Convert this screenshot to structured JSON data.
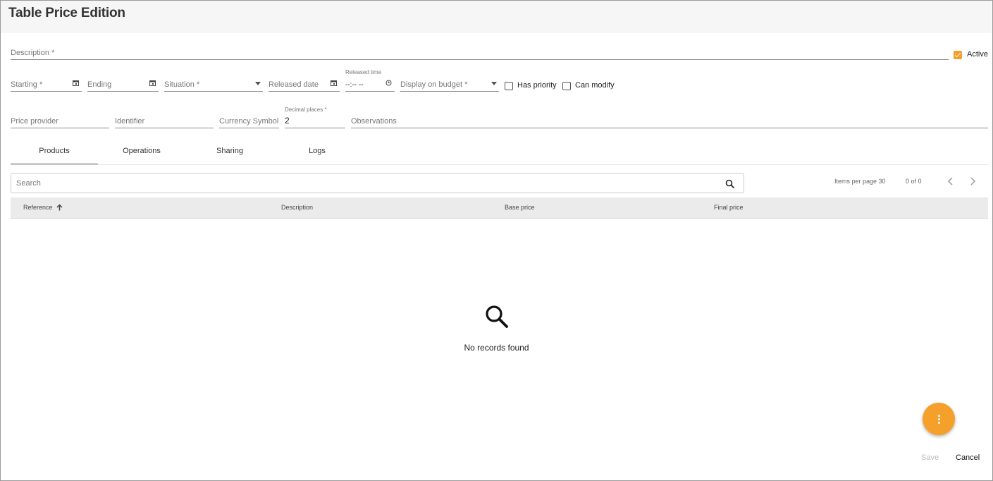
{
  "app": {
    "title": "Table Price Edition"
  },
  "form": {
    "description_placeholder": "Description *",
    "active_label": "Active",
    "active_checked": true,
    "starting_placeholder": "Starting *",
    "ending_placeholder": "Ending",
    "situation_placeholder": "Situation *",
    "released_date_placeholder": "Released date",
    "released_time_label": "Released time",
    "released_time_value": "--:-- --",
    "display_on_budget_placeholder": "Display on budget *",
    "has_priority_label": "Has priority",
    "has_priority_checked": false,
    "can_modify_label": "Can modify",
    "can_modify_checked": false,
    "price_provider_placeholder": "Price provider",
    "identifier_placeholder": "Identifier",
    "currency_symbol_placeholder": "Currency Symbol",
    "decimal_places_label": "Decimal places *",
    "decimal_places_value": "2",
    "observations_placeholder": "Observations"
  },
  "tabs": [
    {
      "label": "Products",
      "active": true
    },
    {
      "label": "Operations",
      "active": false
    },
    {
      "label": "Sharing",
      "active": false
    },
    {
      "label": "Logs",
      "active": false
    }
  ],
  "search": {
    "placeholder": "Search",
    "value": ""
  },
  "pager": {
    "items_per_page_label": "Items per page 30",
    "range_text": "0 of 0"
  },
  "table": {
    "columns": [
      {
        "label": "Reference",
        "sorted": "asc"
      },
      {
        "label": "Description"
      },
      {
        "label": "Base price"
      },
      {
        "label": "Final price"
      }
    ],
    "rows": []
  },
  "empty_state": {
    "text": "No records found",
    "icon": "search-icon"
  },
  "actions": {
    "save_label": "Save",
    "cancel_label": "Cancel",
    "fab_icon": "more-vert-icon"
  },
  "colors": {
    "accent": "#f5a02a",
    "header_bg": "#f6f6f6",
    "table_head_bg": "#ebebeb"
  }
}
